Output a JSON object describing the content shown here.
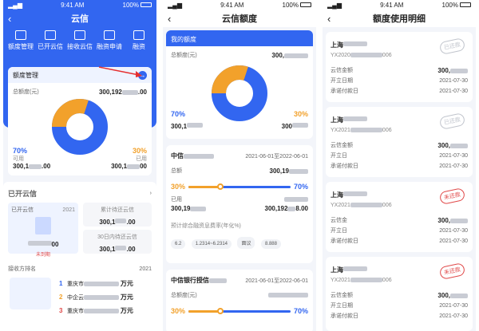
{
  "status": {
    "time": "9:41 AM",
    "battery": "100%"
  },
  "screen1": {
    "title": "云信",
    "quick": [
      "额度管理",
      "已开云信",
      "接收云信",
      "融资申请",
      "融资"
    ],
    "card_title": "额度管理",
    "total_label": "总额度(元)",
    "total_value": "300,192",
    "total_tail": ".00",
    "available_pct": "70%",
    "available_label": "可用",
    "available_value": "300,1",
    "available_tail": ".00",
    "used_pct": "30%",
    "used_label": "已用",
    "used_value": "300,1",
    "used_tail": "00",
    "opened_title": "已开云信",
    "opened_year": "2021",
    "opened_box_title": "已开云信",
    "opened_box_value": "00",
    "opened_box_tag": "未到期",
    "pending_title": "累计待还云信",
    "pending_value": "300,1",
    "pending_tail": ".00",
    "due_title": "30日内待还云信",
    "due_value": "300,1",
    "due_tail": ".00",
    "rank_title": "接收方排名",
    "rank_year": "2021",
    "ranks": [
      {
        "no": "1",
        "name": "重庆市",
        "amount": "万元"
      },
      {
        "no": "2",
        "name": "中企云",
        "amount": "万元"
      },
      {
        "no": "3",
        "name": "重庆市",
        "amount": "万元"
      }
    ]
  },
  "screen2": {
    "title": "云信额度",
    "my_quota": "我的额度",
    "total_label": "总额度(元)",
    "total_value": "300,",
    "left_pct": "70%",
    "right_pct": "30%",
    "left_value": "300,1",
    "right_value": "300",
    "item1": {
      "bank": "中信",
      "date": "2021-06-01至2022-06-01",
      "total_label": "总额",
      "total_value": "300,19",
      "left_pct": "30%",
      "right_pct": "70%",
      "used_label": "已用",
      "used_value": "300,19",
      "used_right": "300,192",
      "used_right_tail": "8.00",
      "rate_label": "预计综合融资息费率(年化%)",
      "rates": [
        "6.2",
        "1.2314~6.2314",
        "面议",
        "8.888"
      ]
    },
    "item2": {
      "bank": "中信银行授信",
      "date": "2021-06-01至2022-06-01",
      "total_label": "总额度(元)",
      "left_pct": "30%",
      "right_pct": "70%"
    }
  },
  "screen3": {
    "title": "额度使用明细",
    "items": [
      {
        "company": "上海",
        "code": "YX2020",
        "code_tail": "006",
        "stamp": "已还款",
        "l1": "云信金额",
        "v1": "300,",
        "l2": "开立日期",
        "v2": "2021-07-30",
        "l3": "承诺付款日",
        "v3": "2021-07-30"
      },
      {
        "company": "上海",
        "code": "YX2021",
        "code_tail": "006",
        "stamp": "已还款",
        "l1": "云信金额",
        "v1": "300,",
        "l2": "开立日",
        "v2": "2021-07-30",
        "l3": "承诺付款日",
        "v3": "2021-07-30"
      },
      {
        "company": "上海",
        "code": "YX2021",
        "code_tail": "006",
        "stamp": "未还款",
        "l1": "云信金",
        "v1": "300,",
        "l2": "开立日",
        "v2": "2021-07-30",
        "l3": "承诺付款日",
        "v3": "2021-07-30"
      },
      {
        "company": "上海",
        "code": "YX2021",
        "code_tail": "006",
        "stamp": "未还款",
        "l1": "云信金额",
        "v1": "300,",
        "l2": "开立日期",
        "v2": "2021-07-30",
        "l3": "承诺付款日",
        "v3": "2021-07-30"
      }
    ]
  }
}
